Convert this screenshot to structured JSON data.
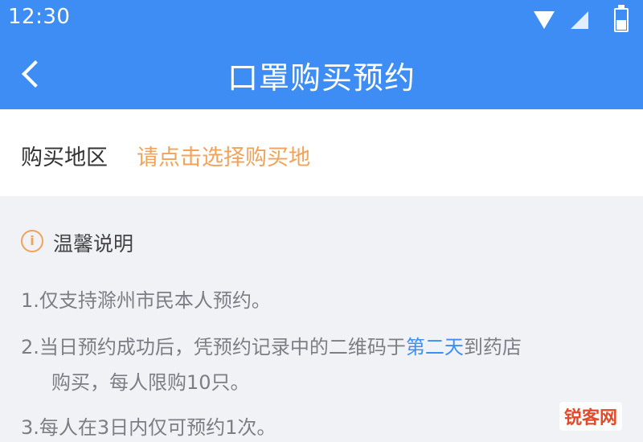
{
  "status_bar": {
    "time": "12:30",
    "icons": [
      "wifi-icon",
      "signal-icon",
      "battery-icon"
    ]
  },
  "nav": {
    "title": "口罩购买预约",
    "back_icon": "chevron-left-icon"
  },
  "region": {
    "label": "购买地区",
    "value": "请点击选择购买地"
  },
  "notice": {
    "icon": "info-icon",
    "icon_glyph": "i",
    "title": "温馨说明",
    "items": [
      {
        "text": "1.仅支持滁州市民本人预约。"
      },
      {
        "text_before": "2.当日预约成功后，凭预约记录中的二维码于",
        "highlight": "第二天",
        "text_after": "到药店",
        "continuation": "购买，每人限购10只。"
      },
      {
        "text": "3.每人在3日内仅可预约1次。"
      }
    ]
  },
  "watermark": "锐客网",
  "colors": {
    "primary": "#3d8df4",
    "accent_orange": "#f0a35a",
    "text_gray": "#7b7e84",
    "background": "#f1f2f6"
  }
}
